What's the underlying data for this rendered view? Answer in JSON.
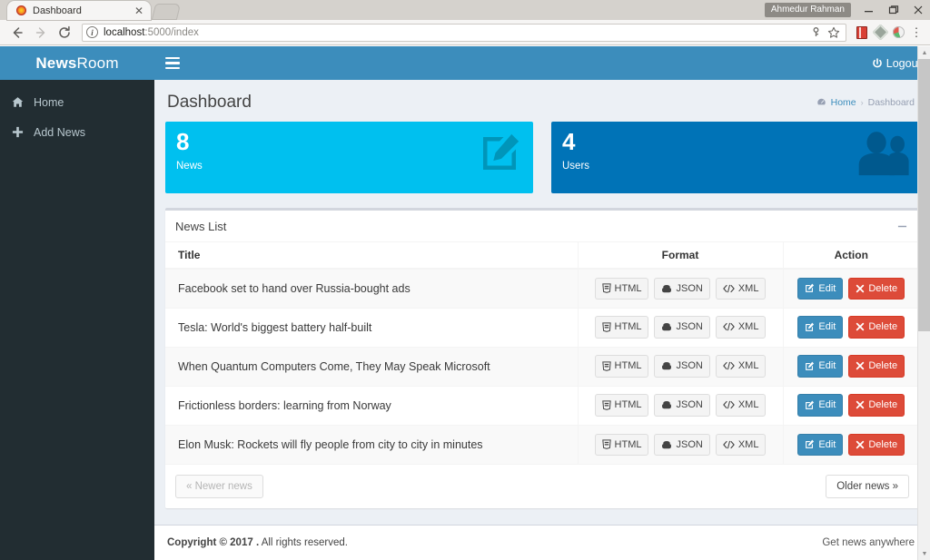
{
  "browser": {
    "tab": {
      "title": "Dashboard",
      "favicon": "newsroom-favicon",
      "close": "✕"
    },
    "new_tab_label": "",
    "user_chip": "Ahmedur Rahman",
    "window_controls": {
      "minimize": "minimize-icon",
      "maximize": "restore-icon",
      "close": "close-icon"
    },
    "nav": {
      "back": "back-arrow-icon",
      "forward": "forward-arrow-icon",
      "reload": "reload-icon"
    },
    "omnibox": {
      "info_icon": "i",
      "url_host": "localhost",
      "url_path": ":5000/index",
      "full_url": "localhost:5000/index",
      "save_icon": "save-password-icon",
      "bookmark_icon": "☆"
    },
    "extensions": [
      "reader-extension-icon",
      "shield-extension-icon",
      "palette-extension-icon"
    ],
    "menu_icon": "⋮"
  },
  "sidebar": {
    "logo": {
      "bold": "News",
      "light": "Room"
    },
    "items": [
      {
        "label": "Home",
        "icon": "home-icon"
      },
      {
        "label": "Add News",
        "icon": "plus-icon"
      }
    ]
  },
  "topnav": {
    "toggle_icon": "hamburger-icon",
    "logout_label": "Logout",
    "logout_icon": "power-icon"
  },
  "header": {
    "title": "Dashboard",
    "breadcrumb": {
      "icon": "dashboard-icon",
      "home": "Home",
      "separator": "›",
      "current": "Dashboard"
    }
  },
  "stats": [
    {
      "number": "8",
      "label": "News",
      "icon": "edit-square-icon",
      "color": "#00c0ef"
    },
    {
      "number": "4",
      "label": "Users",
      "icon": "users-icon",
      "color": "#0073b7"
    }
  ],
  "panel": {
    "title": "News List",
    "collapse_icon": "minus-icon",
    "columns": [
      "Title",
      "Format",
      "Action"
    ],
    "format_buttons": [
      {
        "label": "HTML",
        "icon": "html5-icon"
      },
      {
        "label": "JSON",
        "icon": "database-icon"
      },
      {
        "label": "XML",
        "icon": "code-icon"
      }
    ],
    "action_buttons": [
      {
        "label": "Edit",
        "icon": "edit-icon",
        "style": "primary"
      },
      {
        "label": "Delete",
        "icon": "times-icon",
        "style": "danger"
      }
    ],
    "rows": [
      {
        "title": "Facebook set to hand over Russia-bought ads"
      },
      {
        "title": "Tesla: World's biggest battery half-built"
      },
      {
        "title": "When Quantum Computers Come, They May Speak Microsoft"
      },
      {
        "title": "Frictionless borders: learning from Norway"
      },
      {
        "title": "Elon Musk: Rockets will fly people from city to city in minutes"
      }
    ],
    "pagination": {
      "newer": "« Newer news",
      "older": "Older news »"
    }
  },
  "footer": {
    "copyright_bold": "Copyright © 2017 .",
    "copyright_rest": "All rights reserved.",
    "tagline": "Get news anywhere"
  },
  "theme": {
    "primary": "#3c8dbc",
    "sidebar_bg": "#222d32",
    "body_bg": "#ecf0f5",
    "cyan": "#00c0ef",
    "blue": "#0073b7",
    "danger": "#dd4b39"
  }
}
